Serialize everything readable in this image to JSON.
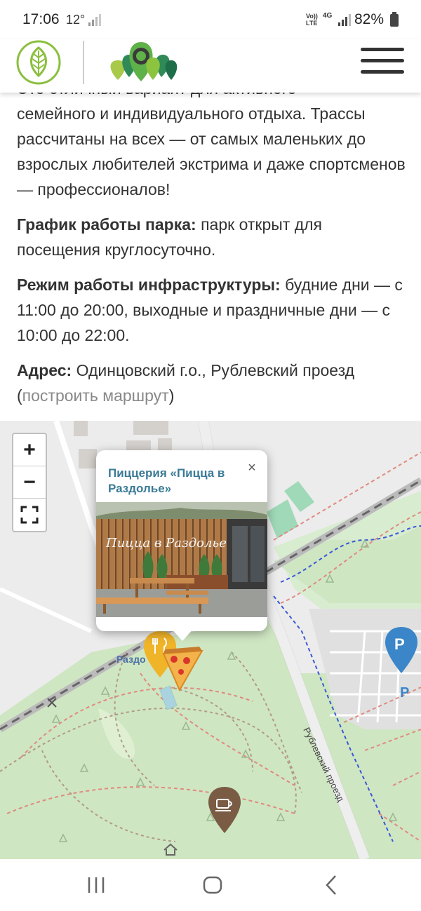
{
  "status_bar": {
    "time": "17:06",
    "temperature": "12°",
    "network_volte": "Vo)) LTE",
    "network_type": "4G",
    "battery": "82%"
  },
  "header": {
    "icons": [
      "leaf-logo-icon",
      "trees-logo-icon",
      "menu-icon"
    ]
  },
  "article": {
    "intro_top": "Это отличный вариант для активного",
    "intro": "семейного и индивидуального отдыха. Трассы рассчитаны на всех — от самых маленьких до взрослых любителей экстрима и даже спортсменов — профессионалов!",
    "schedule_label": "График работы парка:",
    "schedule_text": " парк открыт для посещения круглосуточно.",
    "infra_label": "Режим работы инфраструктуры:",
    "infra_text": " будние дни — с 11:00 до 20:00, выходные и праздничные дни — с 10:00 до 22:00.",
    "address_label": "Адрес:",
    "address_text": " Одинцовский г.о., Рублевский проезд",
    "route_open": " (",
    "route_link": "построить маршрут",
    "route_close": ")"
  },
  "map": {
    "zoom_in": "+",
    "zoom_out": "−",
    "fullscreen_icon": "fullscreen-icon",
    "popup_title": "Пиццерия «Пицца в Раздолье»",
    "popup_close": "×",
    "photo_sign": "Пицца в Раздолье",
    "place_label": "Раздо",
    "street_label": "Рублевский проезд",
    "parking_letter": "P",
    "markers": [
      "restaurant-marker-icon",
      "pizza-icon",
      "cafe-marker-icon",
      "parking-marker-icon",
      "house-icon"
    ],
    "colors": {
      "park_green": "#cfe6c2",
      "popup_title": "#3a7a96",
      "marker_yellow": "#f0b429",
      "marker_brown": "#7a5c44",
      "parking_blue": "#3a86c8"
    }
  },
  "nav_bar": {
    "icons": [
      "recent-apps-icon",
      "home-icon",
      "back-icon"
    ]
  }
}
